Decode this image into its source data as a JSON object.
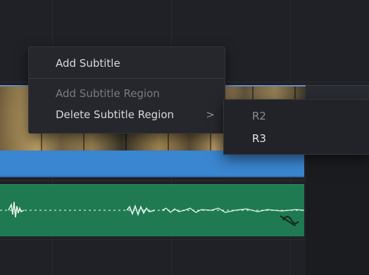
{
  "context_menu": {
    "items": [
      {
        "label": "Add Subtitle",
        "enabled": true
      },
      {
        "label": "Add Subtitle Region",
        "enabled": false
      },
      {
        "label": "Delete Subtitle Region",
        "enabled": true,
        "has_submenu": true,
        "chevron": ">"
      }
    ]
  },
  "submenu": {
    "items": [
      {
        "label": "R2",
        "enabled": false
      },
      {
        "label": "R3",
        "enabled": true
      }
    ]
  },
  "colors": {
    "video_track_border": "#6b8ec4",
    "subtitle_region": "#3a86d0",
    "audio_clip": "#1f7a52",
    "menu_bg": "#26272c"
  }
}
